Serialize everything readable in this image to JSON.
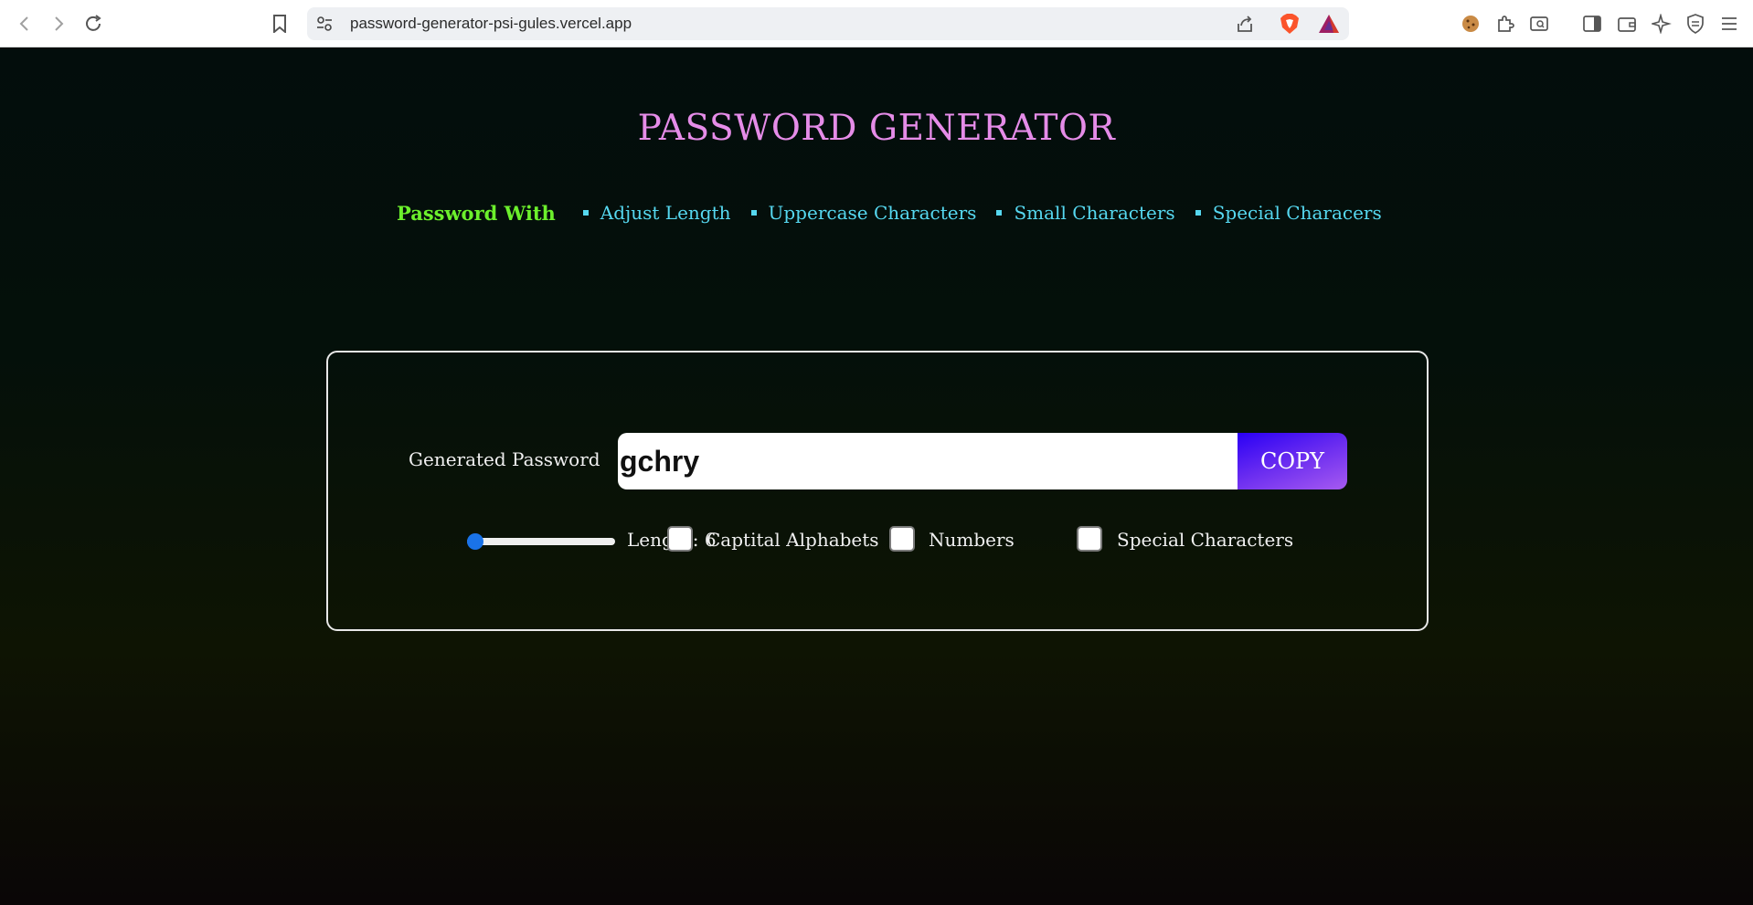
{
  "browser": {
    "url": "password-generator-psi-gules.vercel.app"
  },
  "page": {
    "title": "PASSWORD GENERATOR",
    "features_lead": "Password With",
    "features": [
      "Adjust Length",
      "Uppercase Characters",
      "Small Characters",
      "Special Characers"
    ],
    "generated_label": "Generated Password",
    "password_value": "gchry",
    "copy_label": "COPY",
    "length_label": "Length: 6",
    "length_slider": {
      "min": 6,
      "max": 100,
      "value": 6
    },
    "options": [
      {
        "label": "Captital Alphabets",
        "checked": false
      },
      {
        "label": "Numbers",
        "checked": false
      },
      {
        "label": "Special Characters",
        "checked": false
      }
    ]
  },
  "colors": {
    "title": "#e58ce8",
    "features_lead": "#6cf02c",
    "features_item": "#56d8f0",
    "copy_button_start": "#2a00f5",
    "copy_button_end": "#a65af0",
    "slider_accent": "#1a73e8"
  }
}
